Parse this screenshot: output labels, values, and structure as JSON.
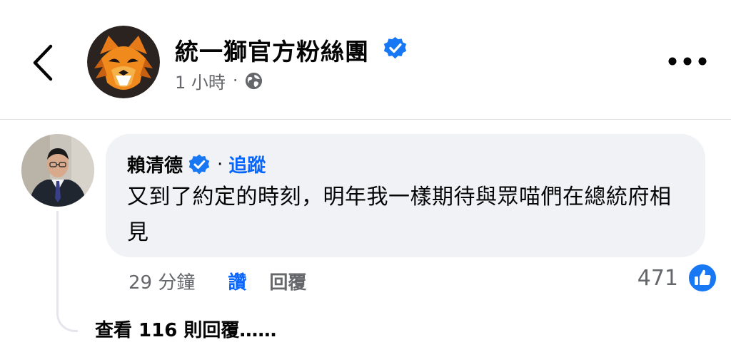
{
  "header": {
    "page_name": "統一獅官方粉絲團",
    "timestamp": "1 小時",
    "separator": "·",
    "back_icon": "chevron-left-icon",
    "more_icon": "more-horizontal-icon",
    "audience_icon": "globe-icon"
  },
  "comment": {
    "author": "賴清德",
    "separator": "·",
    "follow_label": "追蹤",
    "text": "又到了約定的時刻，明年我一樣期待與眾喵們在總統府相見",
    "time": "29 分鐘",
    "like_label": "讚",
    "reply_label": "回覆",
    "reaction_count": "471"
  },
  "replies": {
    "view_more_label": "查看 116 則回覆……"
  },
  "colors": {
    "accent_blue": "#0866ff",
    "muted_text": "#65676b",
    "bubble_bg": "#f0f2f5",
    "verified_blue": "#1877f2"
  }
}
